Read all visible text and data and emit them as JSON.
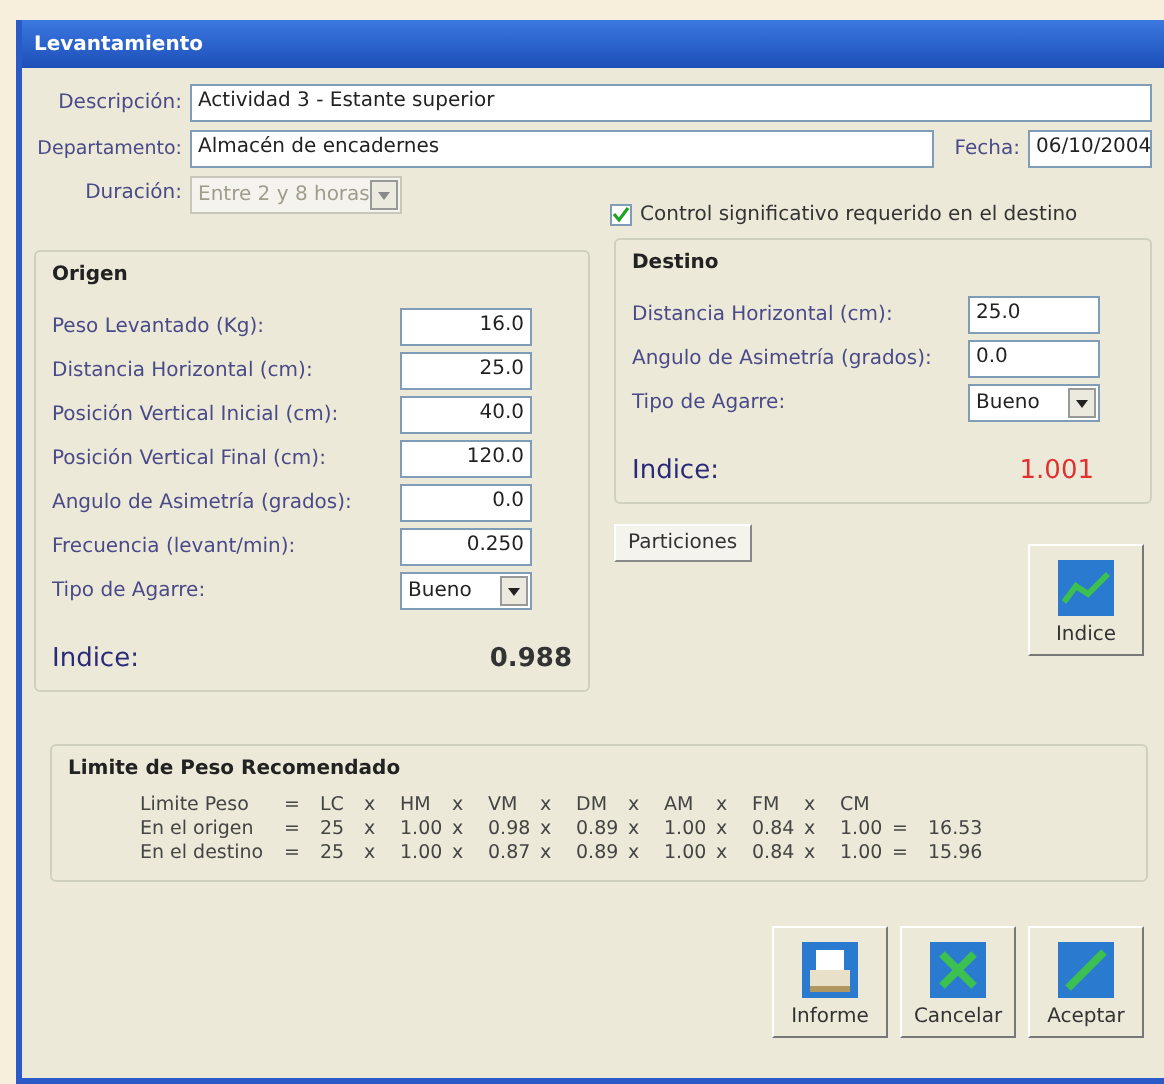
{
  "window": {
    "title": "Levantamiento"
  },
  "header": {
    "description_label": "Descripción:",
    "description": "Actividad 3 - Estante superior",
    "department_label": "Departamento:",
    "department": "Almacén de encadernes",
    "date_label": "Fecha:",
    "date": "06/10/2004",
    "duration_label": "Duración:",
    "duration": "Entre 2 y 8 horas",
    "duration_disabled": true,
    "control": {
      "label": "Control significativo requerido en el destino",
      "checked": true
    }
  },
  "origin": {
    "title": "Origen",
    "fields": [
      {
        "kind": "number",
        "label": "Peso Levantado (Kg):",
        "value": "16.0"
      },
      {
        "kind": "number",
        "label": "Distancia Horizontal (cm):",
        "value": "25.0"
      },
      {
        "kind": "number",
        "label": "Posición Vertical Inicial (cm):",
        "value": "40.0"
      },
      {
        "kind": "number",
        "label": "Posición Vertical Final (cm):",
        "value": "120.0"
      },
      {
        "kind": "number",
        "label": "Angulo de Asimetría (grados):",
        "value": "0.0"
      },
      {
        "kind": "number",
        "label": "Frecuencia (levant/min):",
        "value": "0.250"
      },
      {
        "kind": "select",
        "label": "Tipo de Agarre:",
        "value": "Bueno"
      }
    ],
    "index_label": "Indice:",
    "index": "0.988",
    "index_alert": false
  },
  "destination": {
    "title": "Destino",
    "fields": [
      {
        "kind": "text",
        "label": "Distancia Horizontal (cm):",
        "value": "25.0"
      },
      {
        "kind": "text",
        "label": "Angulo de Asimetría (grados):",
        "value": "0.0"
      },
      {
        "kind": "select",
        "label": "Tipo de Agarre:",
        "value": "Bueno"
      }
    ],
    "index_label": "Indice:",
    "index": "1.001",
    "index_alert": true
  },
  "relations_button": "Particiones",
  "index_button": "Indice",
  "limit": {
    "title": "Limite de Peso Recomendado",
    "rows": [
      [
        "Limite Peso",
        "=",
        "LC",
        "x",
        "HM",
        "x",
        "VM",
        "x",
        "DM",
        "x",
        "AM",
        "x",
        "FM",
        "x",
        "CM",
        "",
        ""
      ],
      [
        "En el origen",
        "=",
        "25",
        "x",
        "1.00",
        "x",
        "0.98",
        "x",
        "0.89",
        "x",
        "1.00",
        "x",
        "0.84",
        "x",
        "1.00",
        "=",
        "16.53"
      ],
      [
        "En el destino",
        "=",
        "25",
        "x",
        "1.00",
        "x",
        "0.87",
        "x",
        "0.89",
        "x",
        "1.00",
        "x",
        "0.84",
        "x",
        "1.00",
        "=",
        "15.96"
      ]
    ]
  },
  "buttons": [
    {
      "kind": "report",
      "label": "Informe"
    },
    {
      "kind": "cancel",
      "label": "Cancelar"
    },
    {
      "kind": "accept",
      "label": "Aceptar"
    }
  ]
}
